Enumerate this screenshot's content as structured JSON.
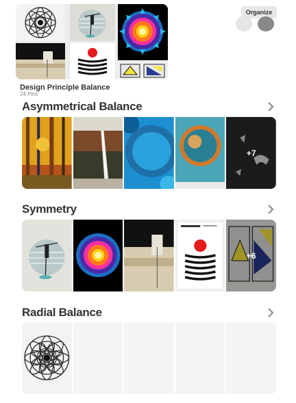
{
  "header": {
    "organize_label": "Organize"
  },
  "board": {
    "title": "Design Principle Balance",
    "pin_count": "24 Pins"
  },
  "sections": [
    {
      "title": "Asymmetrical Balance",
      "more_label": "+7"
    },
    {
      "title": "Symmetry",
      "more_label": "+6"
    },
    {
      "title": "Radial Balance"
    }
  ],
  "icons": {
    "chevron": "chevron-right-icon",
    "avatar": "avatar-icon"
  },
  "colors": {
    "text": "#333333",
    "muted": "#888888",
    "button_bg": "#e7e7e7",
    "placeholder": "#f4f4f4"
  }
}
